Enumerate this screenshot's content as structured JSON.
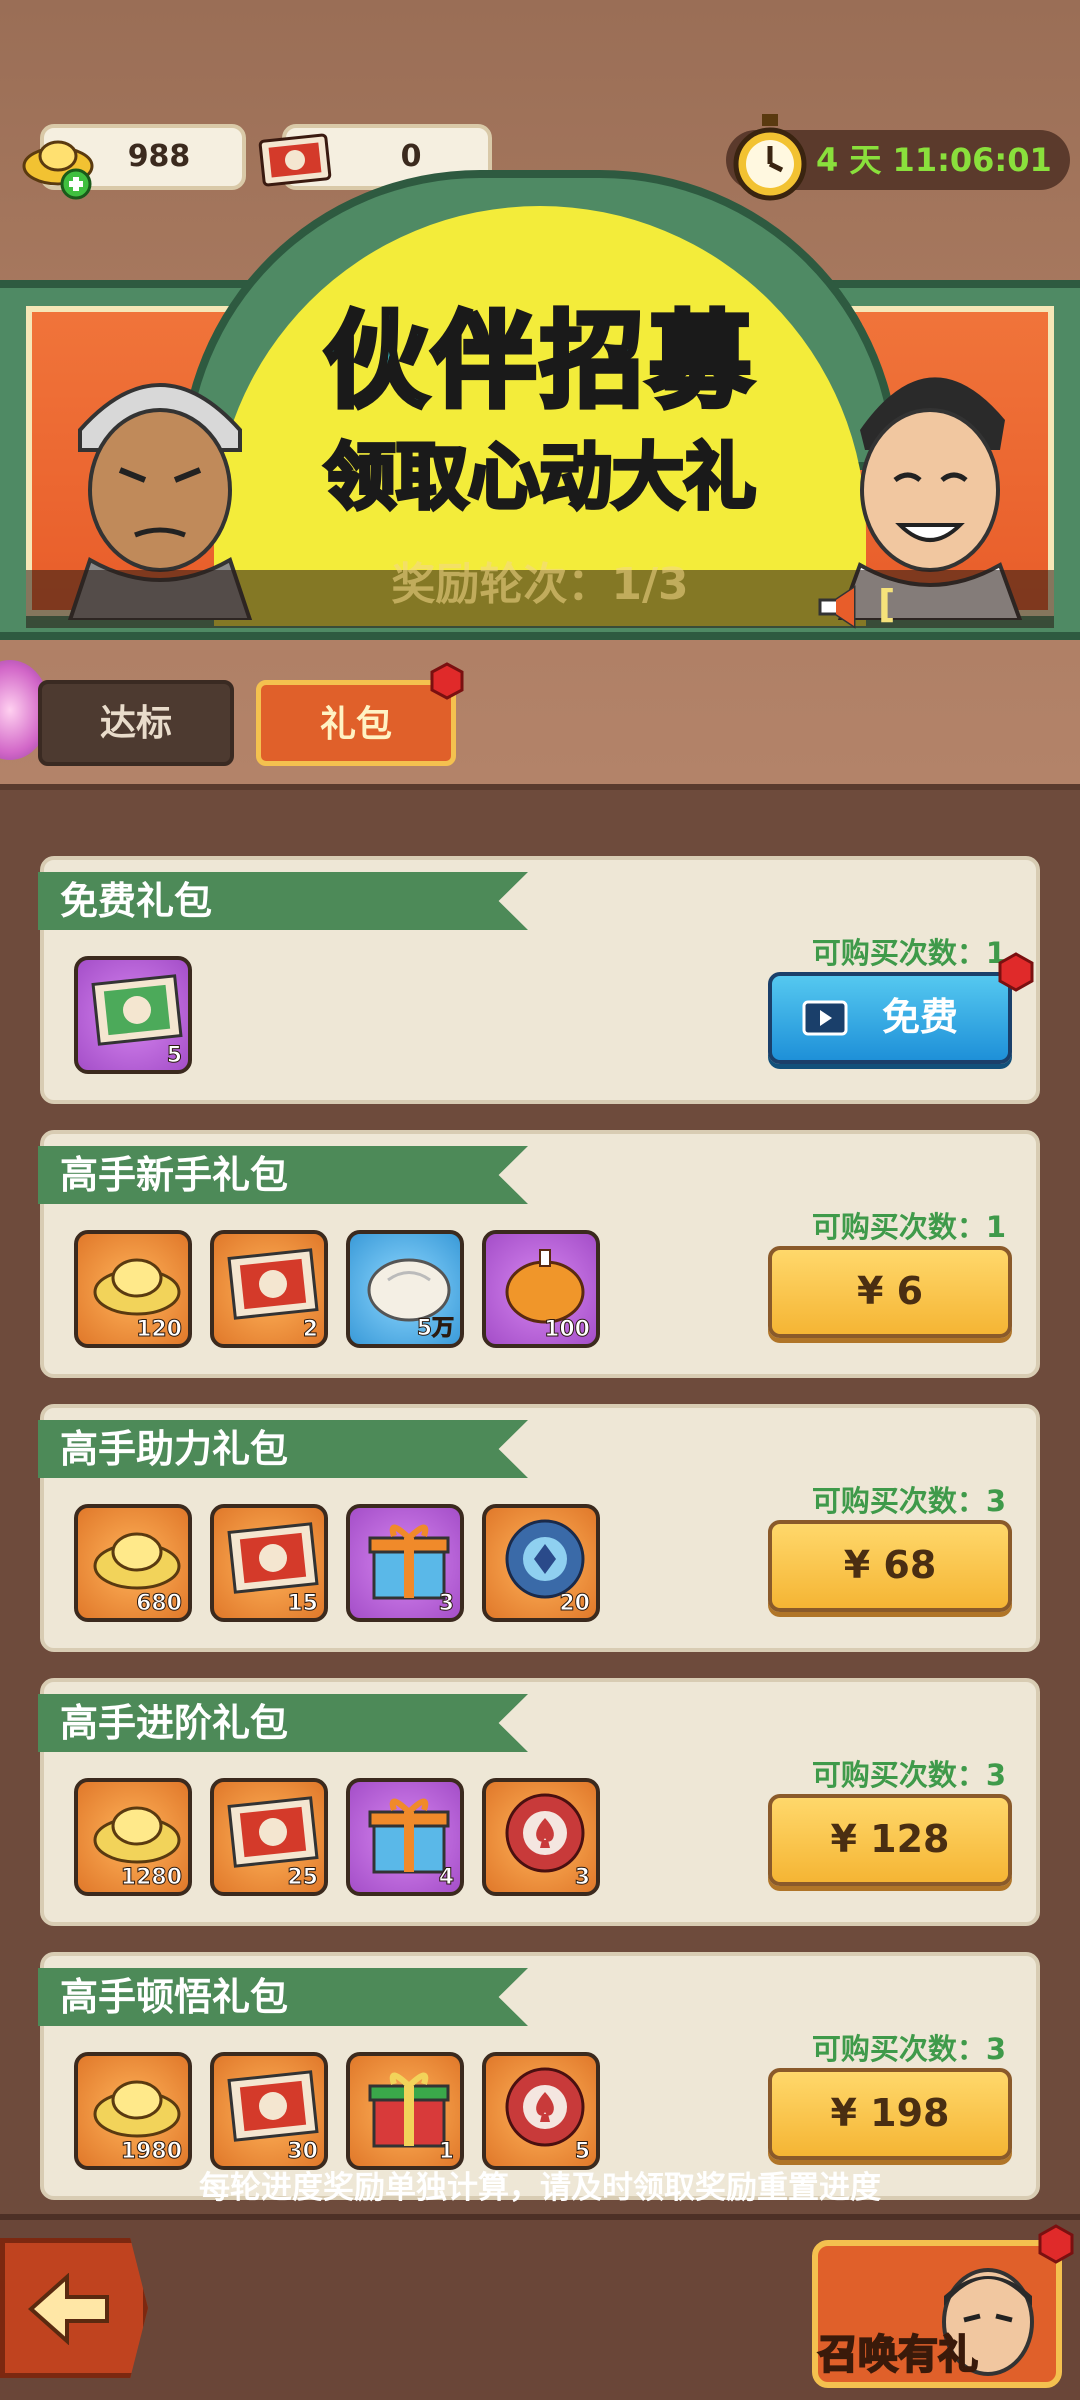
{
  "currency": {
    "gold_value": "988",
    "ticket_value": "0",
    "gold_icon": "gold-ingot-add-icon",
    "ticket_icon": "gao-ticket-icon"
  },
  "timer": {
    "text": "4 天 11:06:01",
    "icon": "stopwatch-icon"
  },
  "banner": {
    "title": "伙伴招募",
    "subtitle": "领取心动大礼",
    "round_text": "奖励轮次：1/3",
    "ticker_text": "[",
    "colors": {
      "title": "#3ee3e6",
      "arch": "#f3ec3a",
      "frame": "#4f8a64"
    }
  },
  "tabs": {
    "standard": "达标",
    "gift": "礼包",
    "active": "礼包"
  },
  "packs": [
    {
      "name": "免费礼包",
      "buy_count": "可购买次数：1",
      "button": "免费",
      "button_type": "free",
      "items": [
        {
          "icon": "pu-ticket-icon",
          "qty": "5",
          "bg": "purple"
        }
      ]
    },
    {
      "name": "高手新手礼包",
      "buy_count": "可购买次数：1",
      "button": "¥ 6",
      "button_type": "price",
      "items": [
        {
          "icon": "gold-ingot-icon",
          "qty": "120",
          "bg": "orange"
        },
        {
          "icon": "gao-ticket-icon",
          "qty": "2",
          "bg": "orange"
        },
        {
          "icon": "exp-bun-icon",
          "qty": "5万",
          "bg": "blue"
        },
        {
          "icon": "roast-chicken-icon",
          "qty": "100",
          "bg": "purple"
        }
      ]
    },
    {
      "name": "高手助力礼包",
      "buy_count": "可购买次数：3",
      "button": "¥ 68",
      "button_type": "price",
      "items": [
        {
          "icon": "gold-ingot-icon",
          "qty": "680",
          "bg": "orange"
        },
        {
          "icon": "gao-ticket-icon",
          "qty": "15",
          "bg": "orange"
        },
        {
          "icon": "gift-box-icon",
          "qty": "3",
          "bg": "purple"
        },
        {
          "icon": "blue-chip-icon",
          "qty": "20",
          "bg": "orange"
        }
      ]
    },
    {
      "name": "高手进阶礼包",
      "buy_count": "可购买次数：3",
      "button": "¥ 128",
      "button_type": "price",
      "items": [
        {
          "icon": "gold-ingot-icon",
          "qty": "1280",
          "bg": "orange"
        },
        {
          "icon": "gao-ticket-icon",
          "qty": "25",
          "bg": "orange"
        },
        {
          "icon": "gift-box-icon",
          "qty": "4",
          "bg": "purple"
        },
        {
          "icon": "red-spade-chip-icon",
          "qty": "3",
          "bg": "orange"
        }
      ]
    },
    {
      "name": "高手顿悟礼包",
      "buy_count": "可购买次数：3",
      "button": "¥ 198",
      "button_type": "price",
      "items": [
        {
          "icon": "gold-ingot-icon",
          "qty": "1980",
          "bg": "orange"
        },
        {
          "icon": "gao-ticket-icon",
          "qty": "30",
          "bg": "orange"
        },
        {
          "icon": "gift-box-red-green-icon",
          "qty": "1",
          "bg": "orange"
        },
        {
          "icon": "red-spade-chip-icon",
          "qty": "5",
          "bg": "orange"
        }
      ]
    }
  ],
  "footer": {
    "note": "每轮进度奖励单独计算，请及时领取奖励重置进度",
    "back_icon": "back-arrow-icon",
    "summon_label": "召唤有礼"
  }
}
